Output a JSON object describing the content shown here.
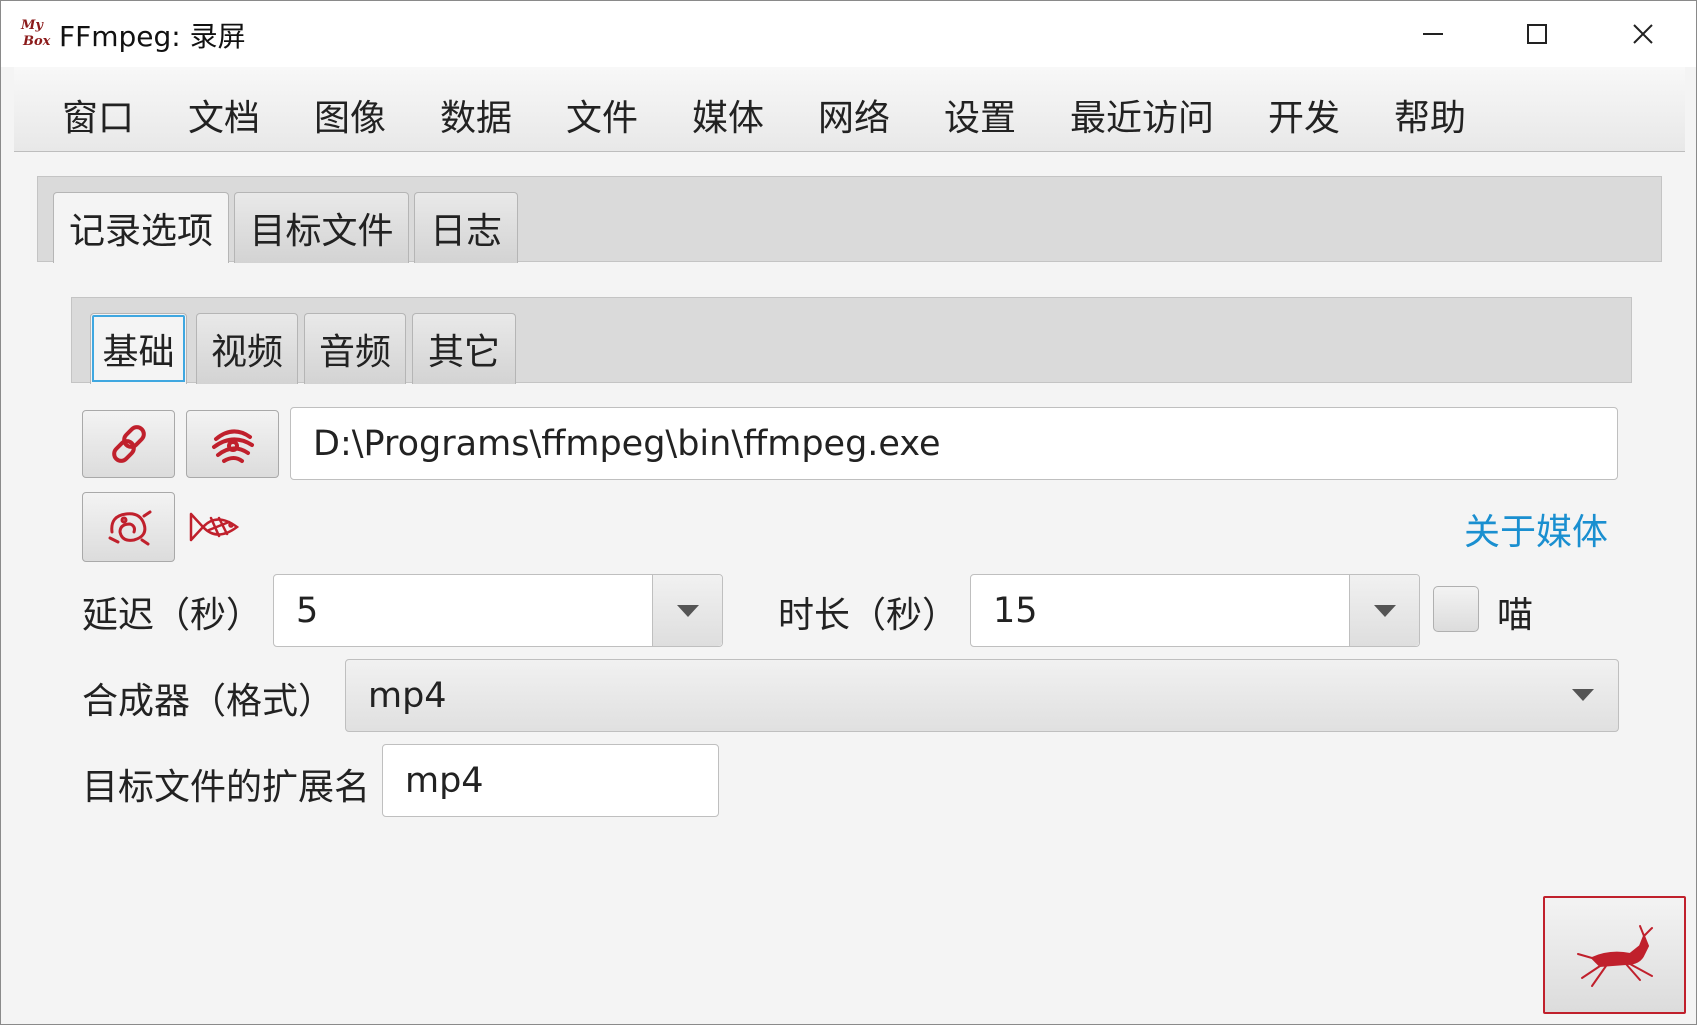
{
  "window": {
    "title": "FFmpeg: 录屏",
    "logo_text": "My Box"
  },
  "icons": {
    "app_logo": "mybox-logo-icon",
    "minimize": "minimize-icon",
    "maximize": "maximize-icon",
    "close": "close-icon",
    "link": "chain-link-icon",
    "download": "spiral-cloud-icon",
    "settings": "coiled-dragon-icon",
    "fish": "fish-icon",
    "start": "running-deer-icon"
  },
  "menu": [
    "窗口",
    "文档",
    "图像",
    "数据",
    "文件",
    "媒体",
    "网络",
    "设置",
    "最近访问",
    "开发",
    "帮助"
  ],
  "tabs": {
    "items": [
      "记录选项",
      "目标文件",
      "日志"
    ],
    "selected": "记录选项"
  },
  "subtabs": {
    "items": [
      "基础",
      "视频",
      "音频",
      "其它"
    ],
    "selected": "基础"
  },
  "form": {
    "ffmpeg_path": "D:\\Programs\\ffmpeg\\bin\\ffmpeg.exe",
    "about_link": "关于媒体",
    "delay_label": "延迟（秒）",
    "delay_value": "5",
    "duration_label": "时长（秒）",
    "duration_value": "15",
    "miao_checkbox_label": "喵",
    "miao_checked": false,
    "muxer_label": "合成器（格式）",
    "muxer_value": "mp4",
    "ext_label": "目标文件的扩展名",
    "ext_value": "mp4"
  },
  "colors": {
    "accent": "#c0202c",
    "link": "#1a8fd0",
    "focus": "#3fa7e0"
  }
}
